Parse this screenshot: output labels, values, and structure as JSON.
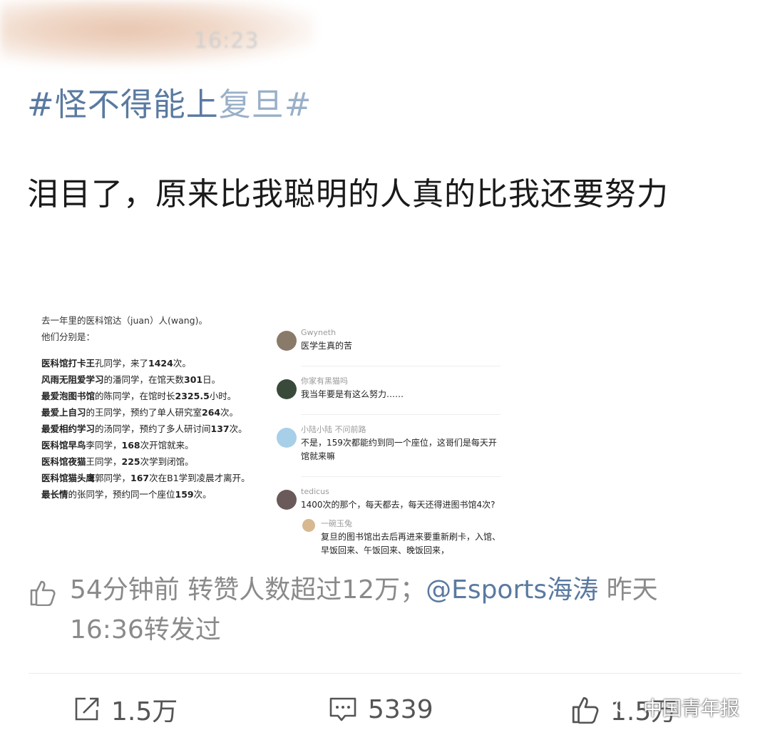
{
  "header": {
    "time": "16:23"
  },
  "post": {
    "topic_main": "#怪不得能上",
    "topic_tail": "复旦#",
    "text": "泪目了，原来比我聪明的人真的比我还要努力"
  },
  "embedded_image": {
    "left": {
      "intro_1": "去一年里的医科馆达（juan）人(wang)。",
      "intro_2": "他们分别是：",
      "lines": [
        {
          "bold": "医科馆打卡王",
          "rest_1": "孔同学，来了",
          "bold_2": "1424",
          "rest_2": "次。"
        },
        {
          "bold": "风雨无阻爱学习",
          "rest_1": "的潘同学，在馆天数",
          "bold_2": "301",
          "rest_2": "日。"
        },
        {
          "bold": "最爱泡图书馆",
          "rest_1": "的陈同学，在馆时长",
          "bold_2": "2325.5",
          "rest_2": "小时。"
        },
        {
          "bold": "最爱上自习",
          "rest_1": "的王同学，预约了单人研究室",
          "bold_2": "264",
          "rest_2": "次。"
        },
        {
          "bold": "最爱相约学习",
          "rest_1": "的汤同学，预约了多人研讨间",
          "bold_2": "137",
          "rest_2": "次。"
        },
        {
          "bold": "医科馆早鸟",
          "rest_1": "李同学，",
          "bold_2": "168",
          "rest_2": "次开馆就来。"
        },
        {
          "bold": "医科馆夜猫",
          "rest_1": "王同学，",
          "bold_2": "225",
          "rest_2": "次学到闭馆。"
        },
        {
          "bold": "医科馆猫头鹰",
          "rest_1": "郭同学，",
          "bold_2": "167",
          "rest_2": "次在B1学到凌晨才离开。"
        },
        {
          "bold": "最长情",
          "rest_1": "的张同学，预约同一个座位",
          "bold_2": "159",
          "rest_2": "次。"
        }
      ]
    },
    "comments": [
      {
        "name": "Gwyneth",
        "text": "医学生真的苦",
        "avatar_color": "#8a7a6a"
      },
      {
        "name": "你家有黑猫吗",
        "text": "我当年要是有这么努力……",
        "avatar_color": "#3a4a3a"
      },
      {
        "name": "小陆小陆 不问前路",
        "text": "不是，159次都能约到同一个座位，这哥们是每天开馆就来嘛",
        "avatar_color": "#a8cfe8"
      },
      {
        "name": "tedicus",
        "text": "1400次的那个，每天都去，每天还得进图书馆4次?",
        "avatar_color": "#6a5a5a"
      }
    ],
    "reply": {
      "name": "一碗玉兔",
      "text": "复旦的图书馆出去后再进来要重新刷卡，入馆、早饭回来、午饭回来、晚饭回来，",
      "avatar_color": "#d8b890"
    }
  },
  "meta": {
    "time_ago": "54分钟前",
    "repost_stat": "转赞人数超过12万；",
    "mention": "@Esports海涛",
    "tail_1": "昨天",
    "tail_2": "16:36转发过"
  },
  "actions": {
    "share_count": "1.5万",
    "comment_count": "5339",
    "like_count": "1.5万"
  },
  "watermark": {
    "text": "中国青年报"
  }
}
